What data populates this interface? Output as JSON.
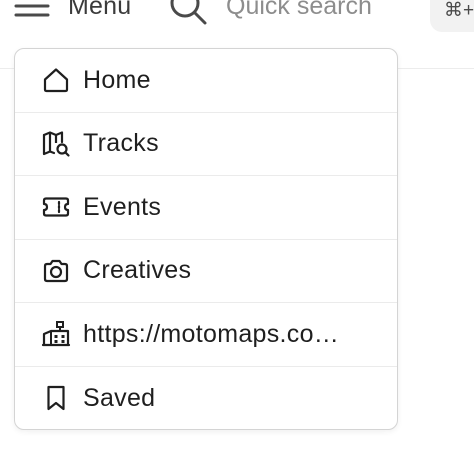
{
  "topbar": {
    "menu_label": "Menu",
    "search_placeholder": "Quick search",
    "shortcut": "⌘+K"
  },
  "menu": {
    "items": [
      {
        "label": "Home",
        "icon": "home-icon"
      },
      {
        "label": "Tracks",
        "icon": "map-search-icon"
      },
      {
        "label": "Events",
        "icon": "ticket-icon"
      },
      {
        "label": "Creatives",
        "icon": "camera-icon"
      },
      {
        "label": "https://motomaps.co…",
        "icon": "building-icon"
      },
      {
        "label": "Saved",
        "icon": "bookmark-icon"
      }
    ]
  },
  "colors": {
    "text": "#1f1f1f",
    "muted": "#8d8d8d",
    "border": "#d4d4d4",
    "divider": "#ebebeb"
  }
}
